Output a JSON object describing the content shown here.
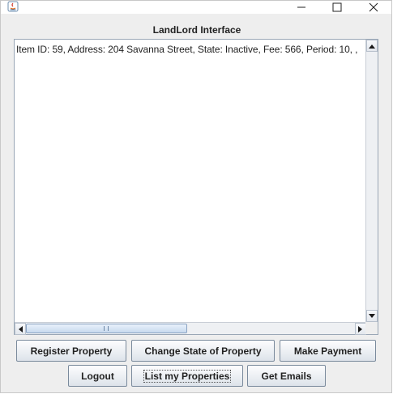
{
  "window": {
    "title": "",
    "controls": {
      "minimize": "—",
      "maximize": "☐",
      "close": "✕"
    }
  },
  "heading": "LandLord Interface",
  "text_area": {
    "lines": [
      "Item ID: 59, Address: 204 Savanna Street, State: Inactive, Fee: 566, Period: 10, ,"
    ]
  },
  "buttons": {
    "register_property": "Register Property",
    "change_state": "Change State of Property",
    "make_payment": "Make Payment",
    "logout": "Logout",
    "list_properties": "List my Properties",
    "get_emails": "Get Emails"
  },
  "icons": {
    "app": "java-icon",
    "scroll_up": "▲",
    "scroll_down": "▼",
    "scroll_left": "◀",
    "scroll_right": "▶"
  },
  "colors": {
    "window_bg": "#eeeeee",
    "button_border": "#7a8a9c",
    "thumb": "#c7d9ee"
  }
}
